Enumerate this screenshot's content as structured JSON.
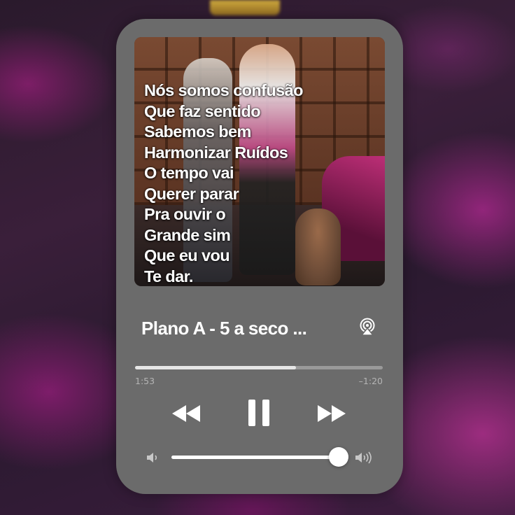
{
  "player": {
    "song_title": "Plano A - 5 a seco ...",
    "lyrics": [
      "Nós somos confusão",
      "Que faz sentido",
      "Sabemos bem",
      "Harmonizar Ruídos",
      "O tempo vai",
      "Querer parar",
      "Pra ouvir o",
      "Grande sim",
      "Que eu vou",
      "Te dar."
    ],
    "elapsed": "1:53",
    "remaining": "–1:20",
    "progress_fraction": 0.65,
    "volume_fraction": 0.95
  },
  "icons": {
    "airplay": "airplay-audio-icon",
    "rewind": "rewind-icon",
    "pause": "pause-icon",
    "forward": "fast-forward-icon",
    "volume_low": "speaker-low-icon",
    "volume_high": "speaker-high-icon"
  },
  "colors": {
    "card": "#6b6b6b",
    "progress_fill": "#e6e6e6",
    "progress_track": "#9a9a9a",
    "accent_bg": "#b0288a"
  }
}
